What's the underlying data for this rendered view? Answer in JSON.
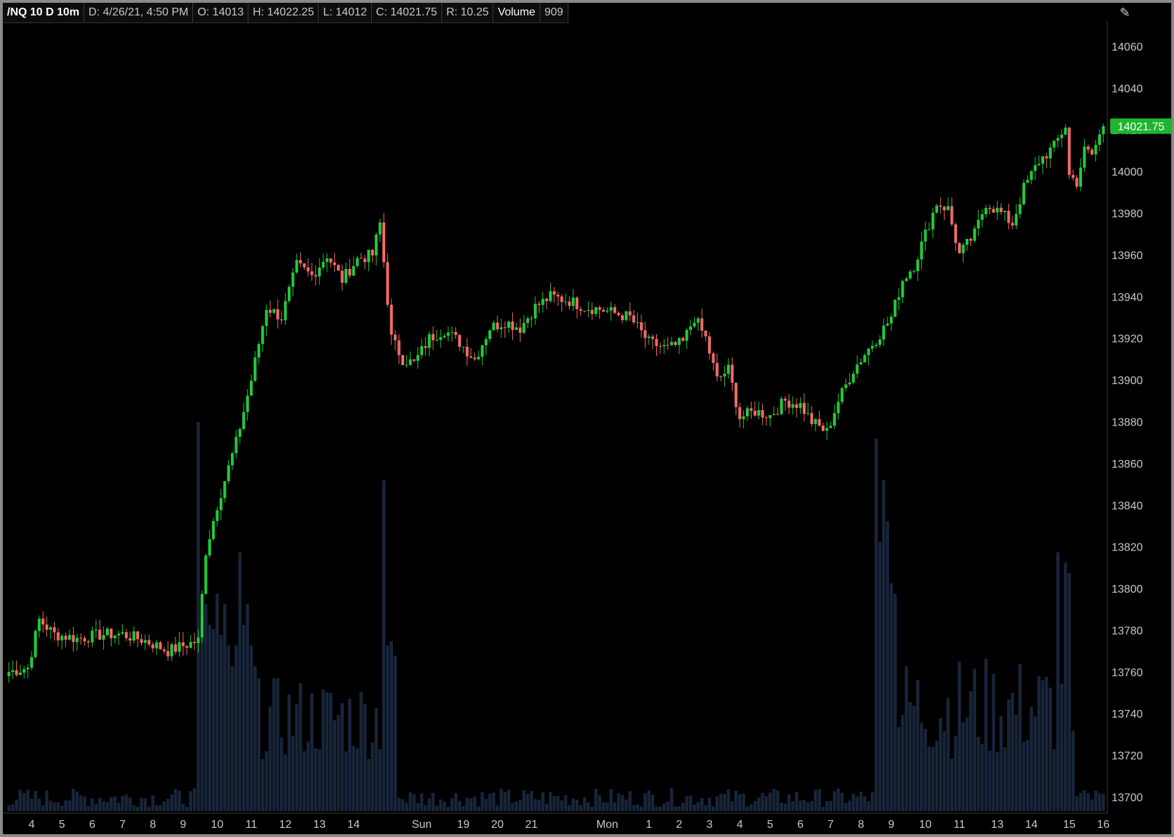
{
  "header": {
    "symbol": "/NQ 10 D 10m",
    "date": "D: 4/26/21, 4:50 PM",
    "open": "O: 14013",
    "high": "H: 14022.25",
    "low": "L: 14012",
    "close": "C: 14021.75",
    "range": "R: 10.25",
    "volume_label": "Volume",
    "volume_value": "909"
  },
  "icons": {
    "toolbar": "drawing-tools-icon"
  },
  "colors": {
    "up": "#22c93a",
    "down": "#f06a6a",
    "volume": "#18253a",
    "price_badge": "#1fb52f",
    "axis_text": "#c8c8c8"
  },
  "chart_data": {
    "type": "candlestick",
    "title": "",
    "xlabel": "",
    "ylabel": "",
    "last_price": "14021.75",
    "ylim": [
      13694,
      14072
    ],
    "y_ticks": [
      13700,
      13720,
      13740,
      13760,
      13780,
      13800,
      13820,
      13840,
      13860,
      13880,
      13900,
      13920,
      13940,
      13960,
      13980,
      14000,
      14020,
      14040,
      14060
    ],
    "x_ticks": [
      {
        "label": "4",
        "i": 6
      },
      {
        "label": "5",
        "i": 14
      },
      {
        "label": "6",
        "i": 22
      },
      {
        "label": "7",
        "i": 30
      },
      {
        "label": "8",
        "i": 38
      },
      {
        "label": "9",
        "i": 46
      },
      {
        "label": "10",
        "i": 55
      },
      {
        "label": "11",
        "i": 64
      },
      {
        "label": "12",
        "i": 73
      },
      {
        "label": "13",
        "i": 82
      },
      {
        "label": "14",
        "i": 91
      },
      {
        "label": "Sun",
        "i": 109
      },
      {
        "label": "19",
        "i": 120
      },
      {
        "label": "20",
        "i": 129
      },
      {
        "label": "21",
        "i": 138
      },
      {
        "label": "Mon",
        "i": 158
      },
      {
        "label": "1",
        "i": 169
      },
      {
        "label": "2",
        "i": 177
      },
      {
        "label": "3",
        "i": 185
      },
      {
        "label": "4",
        "i": 193
      },
      {
        "label": "5",
        "i": 201
      },
      {
        "label": "6",
        "i": 209
      },
      {
        "label": "7",
        "i": 217
      },
      {
        "label": "8",
        "i": 225
      },
      {
        "label": "9",
        "i": 233
      },
      {
        "label": "10",
        "i": 242
      },
      {
        "label": "11",
        "i": 251
      },
      {
        "label": "13",
        "i": 261
      },
      {
        "label": "14",
        "i": 270
      },
      {
        "label": "15",
        "i": 280
      },
      {
        "label": "16",
        "i": 289
      }
    ],
    "anchors": [
      [
        0,
        13760
      ],
      [
        5,
        13762
      ],
      [
        8,
        13785
      ],
      [
        12,
        13778
      ],
      [
        18,
        13776
      ],
      [
        25,
        13778
      ],
      [
        30,
        13778
      ],
      [
        36,
        13775
      ],
      [
        42,
        13770
      ],
      [
        50,
        13775
      ],
      [
        52,
        13818
      ],
      [
        55,
        13840
      ],
      [
        60,
        13870
      ],
      [
        64,
        13900
      ],
      [
        68,
        13935
      ],
      [
        72,
        13930
      ],
      [
        76,
        13955
      ],
      [
        80,
        13950
      ],
      [
        84,
        13960
      ],
      [
        88,
        13948
      ],
      [
        92,
        13958
      ],
      [
        96,
        13960
      ],
      [
        98,
        13975
      ],
      [
        101,
        13920
      ],
      [
        104,
        13910
      ],
      [
        107,
        13908
      ],
      [
        111,
        13920
      ],
      [
        115,
        13924
      ],
      [
        119,
        13918
      ],
      [
        123,
        13910
      ],
      [
        127,
        13925
      ],
      [
        131,
        13928
      ],
      [
        135,
        13925
      ],
      [
        139,
        13935
      ],
      [
        143,
        13940
      ],
      [
        148,
        13938
      ],
      [
        152,
        13935
      ],
      [
        156,
        13934
      ],
      [
        160,
        13932
      ],
      [
        164,
        13930
      ],
      [
        169,
        13918
      ],
      [
        174,
        13915
      ],
      [
        178,
        13918
      ],
      [
        181,
        13930
      ],
      [
        184,
        13920
      ],
      [
        187,
        13900
      ],
      [
        190,
        13905
      ],
      [
        193,
        13882
      ],
      [
        197,
        13885
      ],
      [
        201,
        13883
      ],
      [
        205,
        13890
      ],
      [
        209,
        13888
      ],
      [
        212,
        13880
      ],
      [
        216,
        13875
      ],
      [
        219,
        13890
      ],
      [
        223,
        13905
      ],
      [
        227,
        13915
      ],
      [
        230,
        13922
      ],
      [
        233,
        13930
      ],
      [
        236,
        13948
      ],
      [
        239,
        13955
      ],
      [
        242,
        13970
      ],
      [
        245,
        13985
      ],
      [
        248,
        13982
      ],
      [
        251,
        13960
      ],
      [
        255,
        13970
      ],
      [
        258,
        13985
      ],
      [
        262,
        13980
      ],
      [
        265,
        13975
      ],
      [
        268,
        13992
      ],
      [
        272,
        14005
      ],
      [
        276,
        14012
      ],
      [
        279,
        14022
      ],
      [
        280,
        13998
      ],
      [
        282,
        13995
      ],
      [
        284,
        14010
      ],
      [
        286,
        14008
      ],
      [
        289,
        14021.75
      ]
    ],
    "volume": {
      "ymax": 1900,
      "spikes": [
        [
          50,
          1880
        ],
        [
          51,
          950
        ],
        [
          52,
          1000
        ],
        [
          53,
          900
        ],
        [
          54,
          880
        ],
        [
          55,
          1050
        ],
        [
          56,
          850
        ],
        [
          57,
          1000
        ],
        [
          58,
          800
        ],
        [
          59,
          700
        ],
        [
          60,
          800
        ],
        [
          61,
          1250
        ],
        [
          62,
          900
        ],
        [
          63,
          1000
        ],
        [
          64,
          800
        ],
        [
          65,
          700
        ],
        [
          99,
          1600
        ],
        [
          100,
          800
        ],
        [
          101,
          820
        ],
        [
          102,
          750
        ],
        [
          229,
          1800
        ],
        [
          230,
          1300
        ],
        [
          231,
          1600
        ],
        [
          232,
          1400
        ],
        [
          233,
          1100
        ],
        [
          234,
          1050
        ],
        [
          277,
          1250
        ],
        [
          279,
          1200
        ],
        [
          280,
          1150
        ]
      ]
    }
  }
}
